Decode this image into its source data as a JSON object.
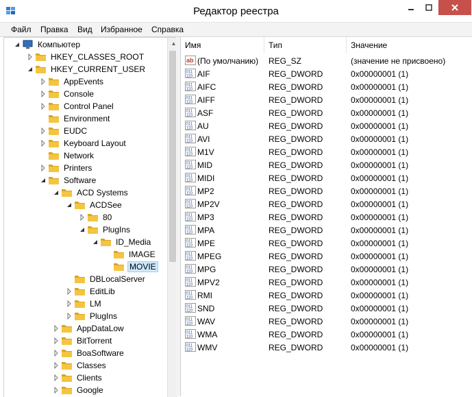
{
  "window": {
    "title": "Редактор реестра"
  },
  "menu": [
    "Файл",
    "Правка",
    "Вид",
    "Избранное",
    "Справка"
  ],
  "tree": [
    {
      "label": "Компьютер",
      "level": 0,
      "exp": "open",
      "icon": "computer"
    },
    {
      "label": "HKEY_CLASSES_ROOT",
      "level": 1,
      "exp": "closed",
      "icon": "folder"
    },
    {
      "label": "HKEY_CURRENT_USER",
      "level": 1,
      "exp": "open",
      "icon": "folder"
    },
    {
      "label": "AppEvents",
      "level": 2,
      "exp": "closed",
      "icon": "folder"
    },
    {
      "label": "Console",
      "level": 2,
      "exp": "closed",
      "icon": "folder"
    },
    {
      "label": "Control Panel",
      "level": 2,
      "exp": "closed",
      "icon": "folder"
    },
    {
      "label": "Environment",
      "level": 2,
      "exp": "none",
      "icon": "folder"
    },
    {
      "label": "EUDC",
      "level": 2,
      "exp": "closed",
      "icon": "folder"
    },
    {
      "label": "Keyboard Layout",
      "level": 2,
      "exp": "closed",
      "icon": "folder"
    },
    {
      "label": "Network",
      "level": 2,
      "exp": "none",
      "icon": "folder"
    },
    {
      "label": "Printers",
      "level": 2,
      "exp": "closed",
      "icon": "folder"
    },
    {
      "label": "Software",
      "level": 2,
      "exp": "open",
      "icon": "folder"
    },
    {
      "label": "ACD Systems",
      "level": 3,
      "exp": "open",
      "icon": "folder"
    },
    {
      "label": "ACDSee",
      "level": 4,
      "exp": "open",
      "icon": "folder"
    },
    {
      "label": "80",
      "level": 5,
      "exp": "closed",
      "icon": "folder"
    },
    {
      "label": "PlugIns",
      "level": 5,
      "exp": "open",
      "icon": "folder"
    },
    {
      "label": "ID_Media",
      "level": 6,
      "exp": "open",
      "icon": "folder"
    },
    {
      "label": "IMAGE",
      "level": 7,
      "exp": "none",
      "icon": "folder"
    },
    {
      "label": "MOVIE",
      "level": 7,
      "exp": "none",
      "icon": "folder",
      "selected": true
    },
    {
      "label": "DBLocalServer",
      "level": 4,
      "exp": "none",
      "icon": "folder"
    },
    {
      "label": "EditLib",
      "level": 4,
      "exp": "closed",
      "icon": "folder"
    },
    {
      "label": "LM",
      "level": 4,
      "exp": "closed",
      "icon": "folder"
    },
    {
      "label": "PlugIns",
      "level": 4,
      "exp": "closed",
      "icon": "folder"
    },
    {
      "label": "AppDataLow",
      "level": 3,
      "exp": "closed",
      "icon": "folder"
    },
    {
      "label": "BitTorrent",
      "level": 3,
      "exp": "closed",
      "icon": "folder"
    },
    {
      "label": "BoaSoftware",
      "level": 3,
      "exp": "closed",
      "icon": "folder"
    },
    {
      "label": "Classes",
      "level": 3,
      "exp": "closed",
      "icon": "folder"
    },
    {
      "label": "Clients",
      "level": 3,
      "exp": "closed",
      "icon": "folder"
    },
    {
      "label": "Google",
      "level": 3,
      "exp": "closed",
      "icon": "folder"
    }
  ],
  "columns": {
    "name": "Имя",
    "type": "Тип",
    "value": "Значение"
  },
  "values": [
    {
      "name": "(По умолчанию)",
      "type": "REG_SZ",
      "data": "(значение не присвоено)",
      "icon": "string"
    },
    {
      "name": "AIF",
      "type": "REG_DWORD",
      "data": "0x00000001 (1)",
      "icon": "binary"
    },
    {
      "name": "AIFC",
      "type": "REG_DWORD",
      "data": "0x00000001 (1)",
      "icon": "binary"
    },
    {
      "name": "AIFF",
      "type": "REG_DWORD",
      "data": "0x00000001 (1)",
      "icon": "binary"
    },
    {
      "name": "ASF",
      "type": "REG_DWORD",
      "data": "0x00000001 (1)",
      "icon": "binary"
    },
    {
      "name": "AU",
      "type": "REG_DWORD",
      "data": "0x00000001 (1)",
      "icon": "binary"
    },
    {
      "name": "AVI",
      "type": "REG_DWORD",
      "data": "0x00000001 (1)",
      "icon": "binary"
    },
    {
      "name": "M1V",
      "type": "REG_DWORD",
      "data": "0x00000001 (1)",
      "icon": "binary"
    },
    {
      "name": "MID",
      "type": "REG_DWORD",
      "data": "0x00000001 (1)",
      "icon": "binary"
    },
    {
      "name": "MIDI",
      "type": "REG_DWORD",
      "data": "0x00000001 (1)",
      "icon": "binary"
    },
    {
      "name": "MP2",
      "type": "REG_DWORD",
      "data": "0x00000001 (1)",
      "icon": "binary"
    },
    {
      "name": "MP2V",
      "type": "REG_DWORD",
      "data": "0x00000001 (1)",
      "icon": "binary"
    },
    {
      "name": "MP3",
      "type": "REG_DWORD",
      "data": "0x00000001 (1)",
      "icon": "binary"
    },
    {
      "name": "MPA",
      "type": "REG_DWORD",
      "data": "0x00000001 (1)",
      "icon": "binary"
    },
    {
      "name": "MPE",
      "type": "REG_DWORD",
      "data": "0x00000001 (1)",
      "icon": "binary"
    },
    {
      "name": "MPEG",
      "type": "REG_DWORD",
      "data": "0x00000001 (1)",
      "icon": "binary"
    },
    {
      "name": "MPG",
      "type": "REG_DWORD",
      "data": "0x00000001 (1)",
      "icon": "binary"
    },
    {
      "name": "MPV2",
      "type": "REG_DWORD",
      "data": "0x00000001 (1)",
      "icon": "binary"
    },
    {
      "name": "RMI",
      "type": "REG_DWORD",
      "data": "0x00000001 (1)",
      "icon": "binary"
    },
    {
      "name": "SND",
      "type": "REG_DWORD",
      "data": "0x00000001 (1)",
      "icon": "binary"
    },
    {
      "name": "WAV",
      "type": "REG_DWORD",
      "data": "0x00000001 (1)",
      "icon": "binary"
    },
    {
      "name": "WMA",
      "type": "REG_DWORD",
      "data": "0x00000001 (1)",
      "icon": "binary"
    },
    {
      "name": "WMV",
      "type": "REG_DWORD",
      "data": "0x00000001 (1)",
      "icon": "binary"
    }
  ],
  "colors": {
    "folder": "#f4c542",
    "folder_dark": "#d9a521",
    "selection": "#cce8ff",
    "close": "#c7504b",
    "binary_icon": "#2b5797",
    "string_icon": "#c0392b"
  }
}
